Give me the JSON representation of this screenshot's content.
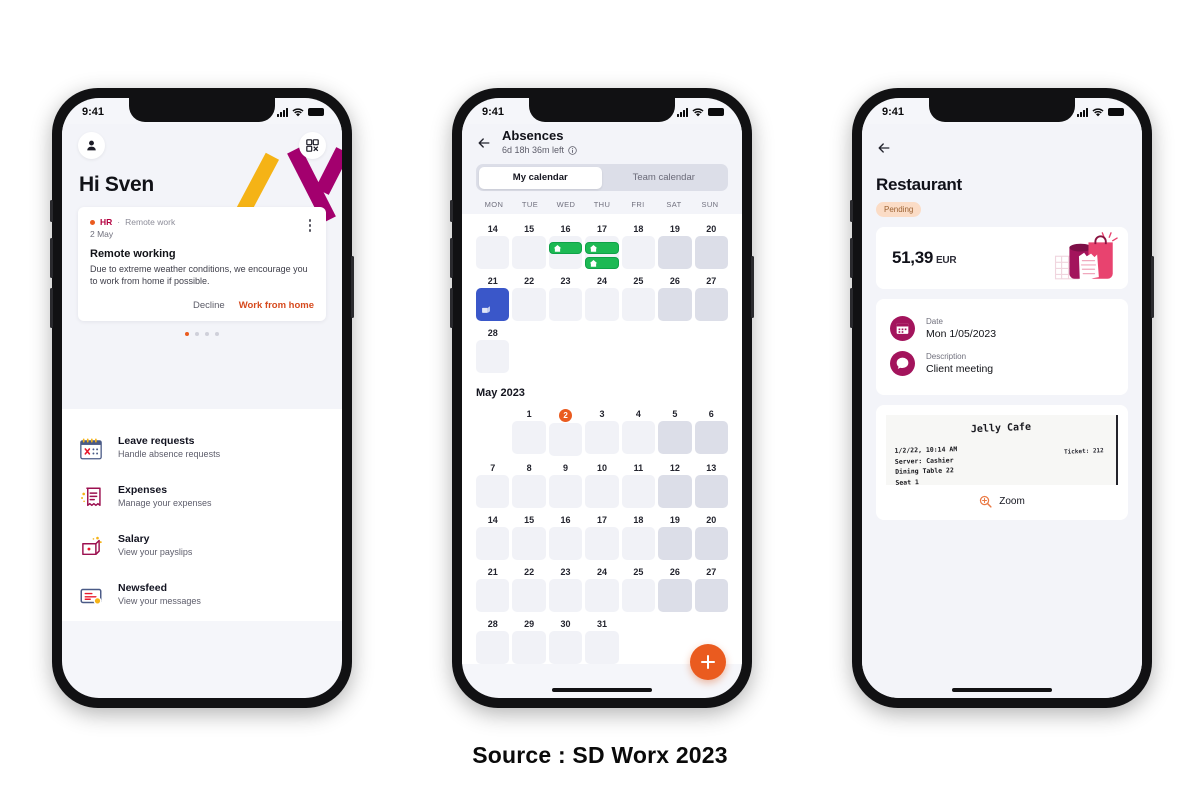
{
  "caption": "Source : SD Worx 2023",
  "colors": {
    "orange": "#ea5b1f",
    "magenta": "#a3006e",
    "yellow": "#f5b316",
    "red": "#e8192c",
    "green": "#1db954",
    "blue": "#3a57c9",
    "pink": "#e8436f",
    "screen_bg": "#f3f4f9"
  },
  "status_bar": {
    "time": "9:41",
    "signal_icon": "cellular-signal-icon",
    "wifi_icon": "wifi-icon",
    "battery_icon": "battery-icon"
  },
  "phone1": {
    "avatar_icon": "person-avatar-icon",
    "qr_icon": "qr-code-icon",
    "greeting": "Hi Sven",
    "news_card": {
      "category": "HR",
      "separator": "·",
      "subject": "Remote work",
      "date": "2 May",
      "menu_icon": "kebab-menu-icon",
      "title": "Remote working",
      "body": "Due to extreme weather conditions, we encourage you to work from home if possible.",
      "decline_label": "Decline",
      "primary_label": "Work from home"
    },
    "carousel": {
      "total": 4,
      "active_index": 0
    },
    "menu": [
      {
        "icon": "calendar-icon",
        "title": "Leave requests",
        "subtitle": "Handle absence requests"
      },
      {
        "icon": "receipt-icon",
        "title": "Expenses",
        "subtitle": "Manage your expenses"
      },
      {
        "icon": "wallet-icon",
        "title": "Salary",
        "subtitle": "View your payslips"
      },
      {
        "icon": "newsfeed-icon",
        "title": "Newsfeed",
        "subtitle": "View your messages"
      }
    ]
  },
  "phone2": {
    "back_icon": "back-arrow-icon",
    "title": "Absences",
    "subtitle": "6d 18h 36m left",
    "info_icon": "info-icon",
    "tabs": [
      {
        "label": "My calendar",
        "active": true
      },
      {
        "label": "Team calendar",
        "active": false
      }
    ],
    "weekday_headers": [
      "MON",
      "TUE",
      "WED",
      "THU",
      "FRI",
      "SAT",
      "SUN"
    ],
    "top_weeks": [
      [
        {
          "day": "14"
        },
        {
          "day": "15"
        },
        {
          "day": "16",
          "events": 1,
          "event_icon": "home-icon"
        },
        {
          "day": "17",
          "events": 2,
          "event_icon": "home-icon"
        },
        {
          "day": "18"
        },
        {
          "day": "19",
          "weekend": true
        },
        {
          "day": "20",
          "weekend": true
        }
      ],
      [
        {
          "day": "21",
          "selected": true,
          "selected_icon": "wallet-icon"
        },
        {
          "day": "22"
        },
        {
          "day": "23"
        },
        {
          "day": "24"
        },
        {
          "day": "25"
        },
        {
          "day": "26",
          "weekend": true
        },
        {
          "day": "27",
          "weekend": true
        }
      ],
      [
        {
          "day": "28"
        },
        {
          "empty": true
        },
        {
          "empty": true
        },
        {
          "empty": true
        },
        {
          "empty": true
        },
        {
          "empty": true
        },
        {
          "empty": true
        }
      ]
    ],
    "month_label": "May 2023",
    "month_weeks": [
      [
        {
          "empty": true
        },
        {
          "day": "1"
        },
        {
          "day": "2",
          "today": true
        },
        {
          "day": "3"
        },
        {
          "day": "4"
        },
        {
          "day": "5",
          "weekend": true
        },
        {
          "day": "6",
          "weekend": true
        }
      ],
      [
        {
          "day": "7"
        },
        {
          "day": "8"
        },
        {
          "day": "9"
        },
        {
          "day": "10"
        },
        {
          "day": "11"
        },
        {
          "day": "12",
          "weekend": true
        },
        {
          "day": "13",
          "weekend": true
        }
      ],
      [
        {
          "day": "14"
        },
        {
          "day": "15"
        },
        {
          "day": "16"
        },
        {
          "day": "17"
        },
        {
          "day": "18"
        },
        {
          "day": "19",
          "weekend": true
        },
        {
          "day": "20",
          "weekend": true
        }
      ],
      [
        {
          "day": "21"
        },
        {
          "day": "22"
        },
        {
          "day": "23"
        },
        {
          "day": "24"
        },
        {
          "day": "25"
        },
        {
          "day": "26",
          "weekend": true
        },
        {
          "day": "27",
          "weekend": true
        }
      ],
      [
        {
          "day": "28"
        },
        {
          "day": "29"
        },
        {
          "day": "30"
        },
        {
          "day": "31"
        },
        {
          "empty": true
        },
        {
          "empty": true
        },
        {
          "empty": true
        }
      ]
    ],
    "fab": {
      "icon": "plus-icon",
      "label": "Add absence"
    }
  },
  "phone3": {
    "back_icon": "back-arrow-icon",
    "title": "Restaurant",
    "status_badge": "Pending",
    "amount": "51,39",
    "currency": "EUR",
    "illustration_icon": "shopping-bag-receipt-illustration",
    "details": [
      {
        "icon": "calendar-icon",
        "label": "Date",
        "value": "Mon 1/05/2023"
      },
      {
        "icon": "chat-bubble-icon",
        "label": "Description",
        "value": "Client meeting"
      }
    ],
    "receipt": {
      "store": "Jelly Cafe",
      "line1": "1/2/22, 10:14 AM",
      "line2": "Server: Cashier",
      "line3": "Dining Table 22",
      "line4": "Seat 1",
      "ticket": "Ticket: 212"
    },
    "zoom_icon": "magnifier-plus-icon",
    "zoom_label": "Zoom"
  }
}
